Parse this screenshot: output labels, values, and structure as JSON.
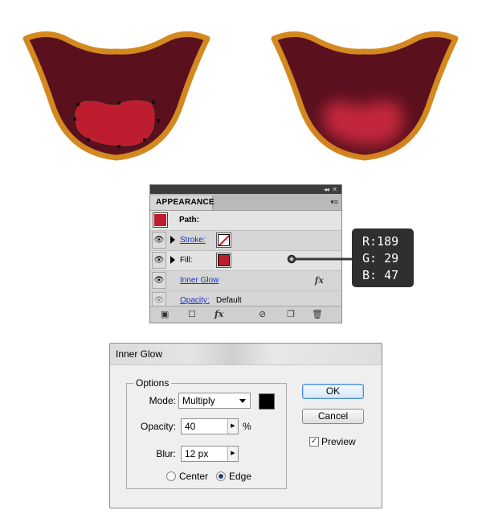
{
  "appearance_panel": {
    "tab_title": "APPEARANCE",
    "collapse_glyph": "◂◂",
    "close_glyph": "✕",
    "menu_glyph": "▾≡",
    "path_label": "Path:",
    "rows": [
      {
        "label": "Stroke:"
      },
      {
        "label": "Fill:"
      },
      {
        "label": "Inner Glow"
      },
      {
        "label": "Opacity:",
        "value": "Default"
      }
    ],
    "fx_glyph": "fx",
    "fill_color": "#bd1d2f"
  },
  "rgb_callout": {
    "r": "R:189",
    "g": "G: 29",
    "b": "B: 47"
  },
  "inner_glow_dialog": {
    "title": "Inner Glow",
    "options_legend": "Options",
    "mode_label": "Mode:",
    "mode_value": "Multiply",
    "opacity_label": "Opacity:",
    "opacity_value": "40",
    "opacity_unit": "%",
    "blur_label": "Blur:",
    "blur_value": "12 px",
    "center_label": "Center",
    "edge_label": "Edge",
    "ok_label": "OK",
    "cancel_label": "Cancel",
    "preview_label": "Preview",
    "glow_color": "#000000",
    "selected_position": "Edge",
    "preview_checked": true
  },
  "colors": {
    "mouth_outline": "#d3891f",
    "mouth_inside": "#5b111d",
    "tongue": "#bd1d2f"
  }
}
